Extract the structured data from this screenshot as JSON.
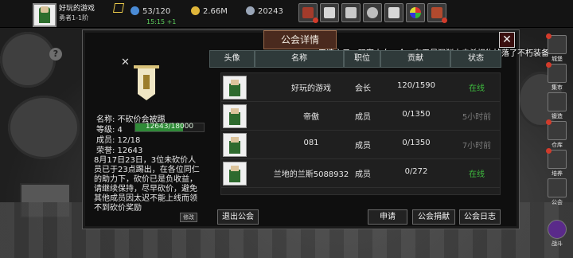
{
  "player": {
    "name": "好玩的游戏",
    "level": "勇者1-1阶"
  },
  "resources": {
    "stamina": "53/120",
    "gold": "2.66M",
    "gems": "20243",
    "timer": "15:15 +1"
  },
  "top_icons": [
    "shop-icon",
    "mail-icon",
    "gamepad-icon",
    "settings-icon",
    "gift-icon",
    "wheel-icon",
    "bag-icon"
  ],
  "dialog": {
    "title": "公会详情",
    "scroll_message": "天选之子，玩家小白一个，在无尽深渊中击杀怪物掉落了不朽装备",
    "close_label": "✕"
  },
  "guild": {
    "name_label": "名称: 不砍价会被踢",
    "level_label": "等级: 4",
    "level_progress": "12643/18000",
    "level_fraction": 0.702,
    "members_label": "成员: 12/18",
    "honor_label": "荣誉: 12643",
    "notice": "8月17日23日，3位未砍价人员已于23点踢出，在各位同仁的助力下，砍价已是负收益，请继续保持，尽早砍价，避免其他成员因太迟不能上线而领不到砍价奖励",
    "modify_label": "修改"
  },
  "table": {
    "headers": [
      "头像",
      "名称",
      "职位",
      "贡献",
      "状态"
    ],
    "rows": [
      {
        "name": "好玩的游戏",
        "role": "会长",
        "contribution": "120/1590",
        "status": "在线",
        "online": true
      },
      {
        "name": "帝傲",
        "role": "成员",
        "contribution": "0/1350",
        "status": "5小时前",
        "online": false
      },
      {
        "name": "081",
        "role": "成员",
        "contribution": "0/1350",
        "status": "7小时前",
        "online": false
      },
      {
        "name": "兰地的兰斯5088932",
        "role": "成员",
        "contribution": "0/272",
        "status": "在线",
        "online": true
      }
    ]
  },
  "buttons": {
    "leave": "退出公会",
    "apply": "申请",
    "donate": "公会捐献",
    "log": "公会日志"
  },
  "right_menu": [
    {
      "label": "城堡",
      "icon": "castle-icon"
    },
    {
      "label": "集市",
      "icon": "market-icon"
    },
    {
      "label": "锻造",
      "icon": "forge-icon"
    },
    {
      "label": "仓库",
      "icon": "warehouse-icon"
    },
    {
      "label": "培养",
      "icon": "training-icon"
    },
    {
      "label": "公会",
      "icon": "guild-icon"
    },
    {
      "label": "战斗",
      "icon": "battle-icon"
    }
  ],
  "colors": {
    "online": "#3fbf3f",
    "offline": "#7a7a7a",
    "title_bg": "#4a2a1e",
    "level_bar": "#2f8a37"
  }
}
